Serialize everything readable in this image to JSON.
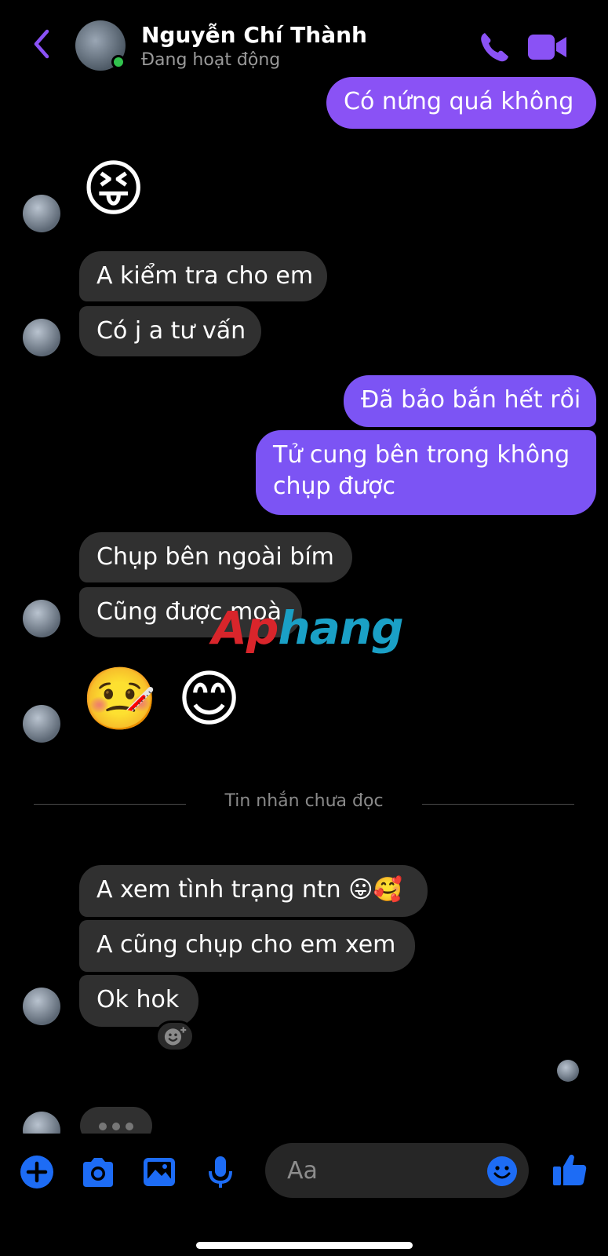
{
  "header": {
    "contact_name": "Nguyễn Chí Thành",
    "status": "Đang hoạt động"
  },
  "messages": [
    {
      "side": "sent",
      "text": "Có nứng quá không"
    },
    {
      "side": "recv",
      "text": "😝"
    },
    {
      "side": "recv",
      "text": "A kiểm tra cho em"
    },
    {
      "side": "recv",
      "text": "Có j a tư vấn"
    },
    {
      "side": "sent",
      "text": "Đã bảo bắn hết rồi"
    },
    {
      "side": "sent",
      "text": "Tử cung bên trong không chụp được"
    },
    {
      "side": "recv",
      "text": "Chụp bên ngoài bím"
    },
    {
      "side": "recv",
      "text": "Cũng được moà"
    },
    {
      "side": "recv",
      "text": "🤒 😊"
    },
    {
      "side": "recv",
      "text": "A xem tình trạng ntn 😛🥰"
    },
    {
      "side": "recv",
      "text": "A cũng chụp cho em xem"
    },
    {
      "side": "recv",
      "text": "Ok hok"
    }
  ],
  "divider": {
    "label": "Tin nhắn chưa đọc"
  },
  "composer": {
    "placeholder": "Aa"
  },
  "watermark": {
    "part1": "Ap",
    "part2": "hang"
  },
  "icons": {
    "back": "chevron-left-icon",
    "call": "phone-icon",
    "video": "video-camera-icon",
    "add": "plus-icon",
    "camera": "camera-icon",
    "gallery": "image-icon",
    "mic": "microphone-icon",
    "emoji": "smiley-icon",
    "like": "thumbs-up-icon"
  },
  "colors": {
    "accent": "#7c54f4",
    "recv_bubble": "#303030",
    "tool_blue": "#1d6cf5",
    "online": "#31c24d"
  }
}
